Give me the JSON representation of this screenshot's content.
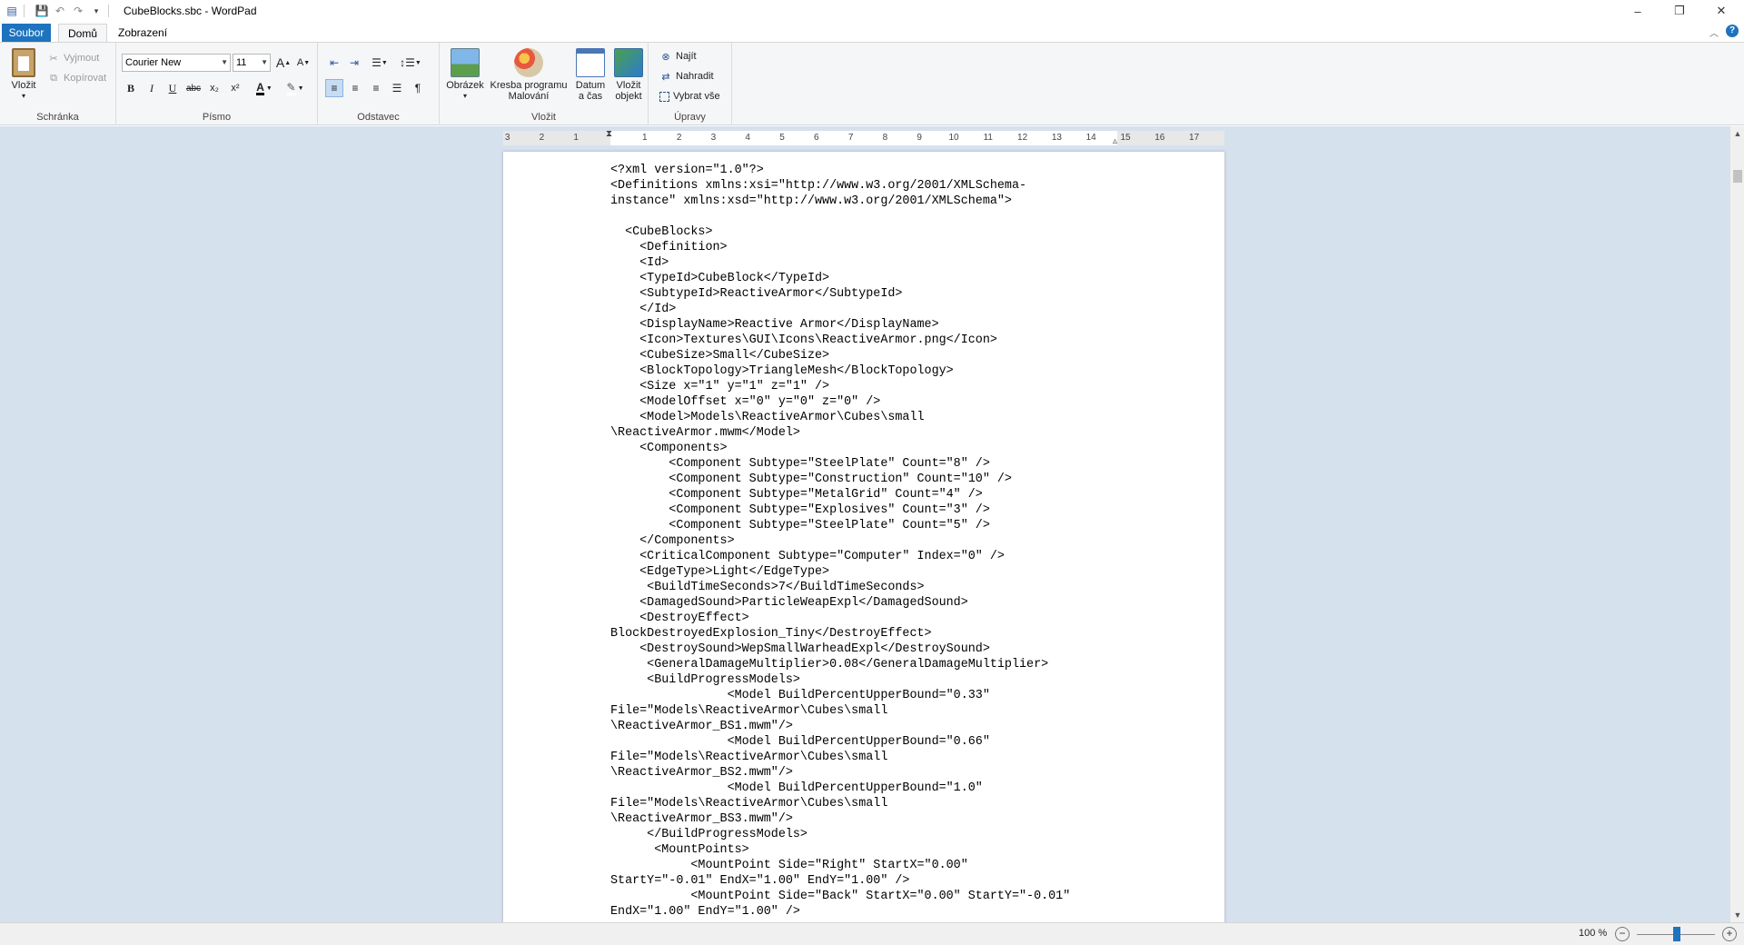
{
  "window": {
    "title": "CubeBlocks.sbc - WordPad",
    "controls": {
      "minimize": "–",
      "restore": "❐",
      "close": "✕"
    }
  },
  "quick_access": {
    "save_icon": "save-icon",
    "undo_icon": "undo-icon",
    "redo_icon": "redo-icon",
    "customize_icon": "chevron-down-icon"
  },
  "tabs": {
    "file": "Soubor",
    "home": "Domů",
    "view": "Zobrazení"
  },
  "ribbon": {
    "clipboard": {
      "label": "Schránka",
      "paste": "Vložit",
      "cut": "Vyjmout",
      "copy": "Kopírovat"
    },
    "font": {
      "label": "Písmo",
      "family": "Courier New",
      "size": "11",
      "bold": "B",
      "italic": "I",
      "underline": "U",
      "strike": "abc",
      "subscript": "x₂",
      "superscript": "x²",
      "grow": "A",
      "shrink": "A"
    },
    "paragraph": {
      "label": "Odstavec"
    },
    "insert": {
      "label": "Vložit",
      "picture": "Obrázek",
      "paint_line1": "Kresba programu",
      "paint_line2": "Malování",
      "datetime_line1": "Datum",
      "datetime_line2": "a čas",
      "object_line1": "Vložit",
      "object_line2": "objekt"
    },
    "editing": {
      "label": "Úpravy",
      "find": "Najít",
      "replace": "Nahradit",
      "select_all": "Vybrat vše"
    }
  },
  "ruler": {
    "ticks": [
      "3",
      "2",
      "1",
      "1",
      "2",
      "3",
      "4",
      "5",
      "6",
      "7",
      "8",
      "9",
      "10",
      "11",
      "12",
      "13",
      "14",
      "15",
      "16",
      "17"
    ]
  },
  "document": {
    "lines": [
      "<?xml version=\"1.0\"?>",
      "<Definitions xmlns:xsi=\"http://www.w3.org/2001/XMLSchema-",
      "instance\" xmlns:xsd=\"http://www.w3.org/2001/XMLSchema\">",
      "",
      "  <CubeBlocks>",
      "    <Definition>",
      "    <Id>",
      "    <TypeId>CubeBlock</TypeId>",
      "    <SubtypeId>ReactiveArmor</SubtypeId>",
      "    </Id>",
      "    <DisplayName>Reactive Armor</DisplayName>",
      "    <Icon>Textures\\GUI\\Icons\\ReactiveArmor.png</Icon>",
      "    <CubeSize>Small</CubeSize>",
      "    <BlockTopology>TriangleMesh</BlockTopology>",
      "    <Size x=\"1\" y=\"1\" z=\"1\" />",
      "    <ModelOffset x=\"0\" y=\"0\" z=\"0\" />",
      "    <Model>Models\\ReactiveArmor\\Cubes\\small",
      "\\ReactiveArmor.mwm</Model>",
      "    <Components>",
      "        <Component Subtype=\"SteelPlate\" Count=\"8\" />",
      "        <Component Subtype=\"Construction\" Count=\"10\" />",
      "        <Component Subtype=\"MetalGrid\" Count=\"4\" />",
      "        <Component Subtype=\"Explosives\" Count=\"3\" />",
      "        <Component Subtype=\"SteelPlate\" Count=\"5\" />",
      "    </Components>",
      "    <CriticalComponent Subtype=\"Computer\" Index=\"0\" />",
      "    <EdgeType>Light</EdgeType>",
      "     <BuildTimeSeconds>7</BuildTimeSeconds>",
      "    <DamagedSound>ParticleWeapExpl</DamagedSound>",
      "    <DestroyEffect>",
      "BlockDestroyedExplosion_Tiny</DestroyEffect>",
      "    <DestroySound>WepSmallWarheadExpl</DestroySound>",
      "     <GeneralDamageMultiplier>0.08</GeneralDamageMultiplier>",
      "     <BuildProgressModels>",
      "                <Model BuildPercentUpperBound=\"0.33\"",
      "File=\"Models\\ReactiveArmor\\Cubes\\small",
      "\\ReactiveArmor_BS1.mwm\"/>",
      "                <Model BuildPercentUpperBound=\"0.66\"",
      "File=\"Models\\ReactiveArmor\\Cubes\\small",
      "\\ReactiveArmor_BS2.mwm\"/>",
      "                <Model BuildPercentUpperBound=\"1.0\"",
      "File=\"Models\\ReactiveArmor\\Cubes\\small",
      "\\ReactiveArmor_BS3.mwm\"/>",
      "     </BuildProgressModels>",
      "      <MountPoints>",
      "           <MountPoint Side=\"Right\" StartX=\"0.00\"",
      "StartY=\"-0.01\" EndX=\"1.00\" EndY=\"1.00\" />",
      "           <MountPoint Side=\"Back\" StartX=\"0.00\" StartY=\"-0.01\"",
      "EndX=\"1.00\" EndY=\"1.00\" />"
    ]
  },
  "status": {
    "zoom": "100 %",
    "zoom_level_percent": 100,
    "zoom_out": "−",
    "zoom_in": "+"
  }
}
